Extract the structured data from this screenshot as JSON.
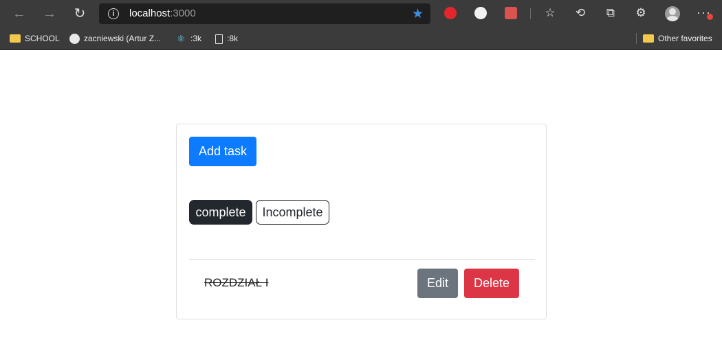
{
  "browser": {
    "url_host": "localhost",
    "url_port": ":3000",
    "bookmarks": [
      {
        "label": "SCHOOL",
        "icon": "folder-icon"
      },
      {
        "label": "zacniewski (Artur Z...",
        "icon": "github-icon"
      },
      {
        "label": ":3k",
        "icon": "react-icon"
      },
      {
        "label": ":8k",
        "icon": "file-icon"
      }
    ],
    "other_favorites": "Other favorites"
  },
  "app": {
    "add_task_label": "Add task",
    "filters": {
      "complete_label": "complete",
      "incomplete_label": "Incomplete",
      "active": "complete"
    },
    "tasks": [
      {
        "title": "ROZDZIAŁ I",
        "completed": true,
        "edit_label": "Edit",
        "delete_label": "Delete"
      }
    ]
  },
  "colors": {
    "primary": "#0d7bff",
    "dark": "#23272e",
    "secondary": "#6c757d",
    "danger": "#dc3545",
    "chrome": "#3b3b3b"
  }
}
